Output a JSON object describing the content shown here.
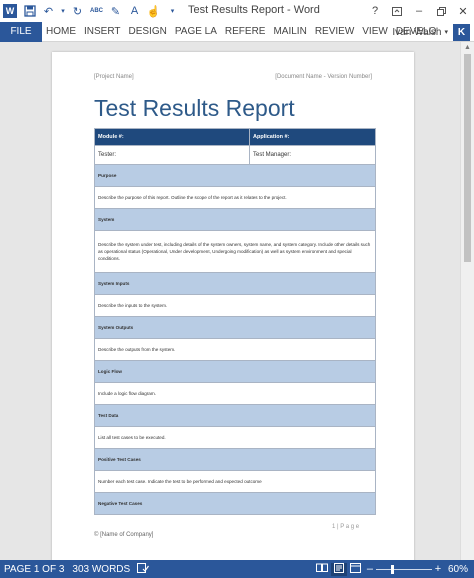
{
  "titlebar": {
    "title": "Test Results Report - Word",
    "icons": [
      "word-logo",
      "save-icon",
      "undo-icon",
      "redo-icon",
      "spelling-check-icon",
      "format-painter-icon",
      "style-dropdown-icon",
      "touch-mode-icon",
      "customize-qat-icon"
    ],
    "spelling_label": "ABC",
    "word_logo": "W",
    "window_controls": [
      "help-icon",
      "ribbon-display-icon",
      "minimize-icon",
      "restore-icon",
      "close-icon"
    ]
  },
  "ribbon": {
    "file_tab": "FILE",
    "tabs": [
      "HOME",
      "INSERT",
      "DESIGN",
      "PAGE LA",
      "REFERE",
      "MAILIN",
      "REVIEW",
      "VIEW",
      "DEVELO"
    ],
    "user_name": "Ivan Walsh",
    "avatar_letter": "K"
  },
  "document": {
    "header_left": "[Project Name]",
    "header_right": "[Document Name - Version Number]",
    "title": "Test Results Report",
    "table": {
      "header": [
        "Module #:",
        "Application #:"
      ],
      "fields": [
        "Tester:",
        "Test Manager:"
      ],
      "rows": [
        {
          "type": "section",
          "text": "Purpose"
        },
        {
          "type": "body",
          "text": "Describe the purpose of this report. Outline the scope of the report as it relates to the project."
        },
        {
          "type": "section",
          "text": "System"
        },
        {
          "type": "body-tall",
          "text": "Describe the system under test, including details of the system owners, system name, and system category. Include other details such as operational status (Operational, Under development, Undergoing modification) as well as system environment and special conditions."
        },
        {
          "type": "section",
          "text": "System Inputs"
        },
        {
          "type": "body",
          "text": "Describe the inputs to the system."
        },
        {
          "type": "section",
          "text": "System Outputs"
        },
        {
          "type": "body",
          "text": "Describe the outputs from the system."
        },
        {
          "type": "section",
          "text": "Logic Flow"
        },
        {
          "type": "body",
          "text": "Include a logic flow diagram."
        },
        {
          "type": "section",
          "text": "Test Data"
        },
        {
          "type": "body",
          "text": "List all test cases to be executed."
        },
        {
          "type": "section",
          "text": "Positive Test Cases"
        },
        {
          "type": "body",
          "text": "Number each test case. Indicate the test to be performed and expected outcome"
        },
        {
          "type": "section",
          "text": "Negative Test Cases"
        }
      ]
    },
    "page_number": "1 | P a g e",
    "footer_company": "© [Name of Company]"
  },
  "statusbar": {
    "page": "PAGE 1 OF 3",
    "words": "303 WORDS",
    "zoom_percent": "60%",
    "zoom_level": 0.6,
    "view_icons": [
      "proofing-icon",
      "read-mode-icon",
      "print-layout-icon",
      "web-layout-icon"
    ]
  },
  "colors": {
    "word_blue": "#2b579a",
    "title_blue": "#2e5a89",
    "table_header": "#1f497d",
    "section_fill": "#b8cce4"
  }
}
